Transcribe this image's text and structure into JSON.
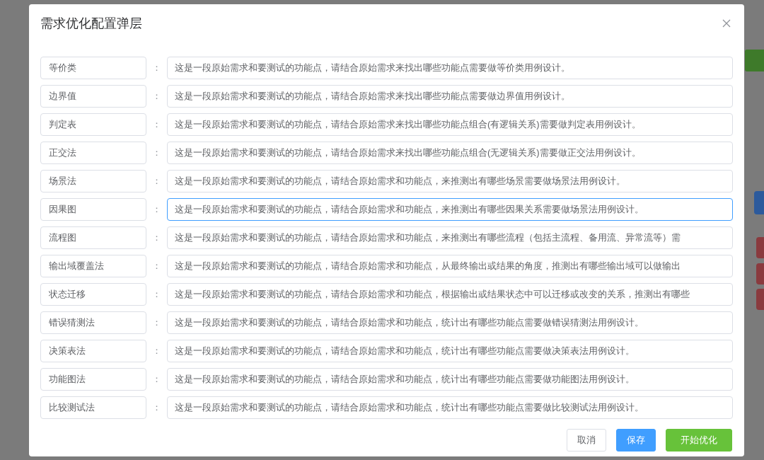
{
  "dialog": {
    "title": "需求优化配置弹层",
    "rows": [
      {
        "label": "等价类",
        "value": "这是一段原始需求和要测试的功能点，请结合原始需求来找出哪些功能点需要做等价类用例设计。",
        "focused": false
      },
      {
        "label": "边界值",
        "value": "这是一段原始需求和要测试的功能点，请结合原始需求来找出哪些功能点需要做边界值用例设计。",
        "focused": false
      },
      {
        "label": "判定表",
        "value": "这是一段原始需求和要测试的功能点，请结合原始需求来找出哪些功能点组合(有逻辑关系)需要做判定表用例设计。",
        "focused": false
      },
      {
        "label": "正交法",
        "value": "这是一段原始需求和要测试的功能点，请结合原始需求来找出哪些功能点组合(无逻辑关系)需要做正交法用例设计。",
        "focused": false
      },
      {
        "label": "场景法",
        "value": "这是一段原始需求和要测试的功能点，请结合原始需求和功能点，来推测出有哪些场景需要做场景法用例设计。",
        "focused": false
      },
      {
        "label": "因果图",
        "value": "这是一段原始需求和要测试的功能点，请结合原始需求和功能点，来推测出有哪些因果关系需要做场景法用例设计。",
        "focused": true
      },
      {
        "label": "流程图",
        "value": "这是一段原始需求和要测试的功能点，请结合原始需求和功能点，来推测出有哪些流程（包括主流程、备用流、异常流等）需",
        "focused": false
      },
      {
        "label": "输出域覆盖法",
        "value": "这是一段原始需求和要测试的功能点，请结合原始需求和功能点，从最终输出或结果的角度，推测出有哪些输出域可以做输出",
        "focused": false
      },
      {
        "label": "状态迁移",
        "value": "这是一段原始需求和要测试的功能点，请结合原始需求和功能点，根据输出或结果状态中可以迁移或改变的关系，推测出有哪些",
        "focused": false
      },
      {
        "label": "错误猜测法",
        "value": "这是一段原始需求和要测试的功能点，请结合原始需求和功能点，统计出有哪些功能点需要做错误猜测法用例设计。",
        "focused": false
      },
      {
        "label": "决策表法",
        "value": "这是一段原始需求和要测试的功能点，请结合原始需求和功能点，统计出有哪些功能点需要做决策表法用例设计。",
        "focused": false
      },
      {
        "label": "功能图法",
        "value": "这是一段原始需求和要测试的功能点，请结合原始需求和功能点，统计出有哪些功能点需要做功能图法用例设计。",
        "focused": false
      },
      {
        "label": "比较测试法",
        "value": "这是一段原始需求和要测试的功能点，请结合原始需求和功能点，统计出有哪些功能点需要做比较测试法用例设计。",
        "focused": false
      }
    ],
    "separator": "：",
    "buttons": [
      {
        "label": "取消",
        "kind": "default"
      },
      {
        "label": "保存",
        "kind": "primary"
      },
      {
        "label": "开始优化",
        "kind": "success"
      }
    ]
  }
}
